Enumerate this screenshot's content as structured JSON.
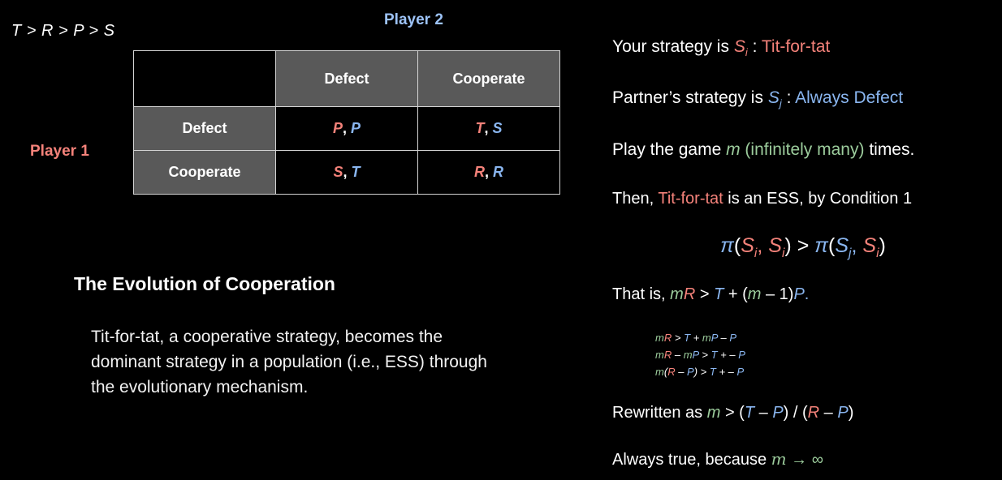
{
  "colors": {
    "background": "#000000",
    "player1": "#f4827a",
    "player2": "#8ab6f0",
    "variable_m": "#9ccc9c",
    "text": "#ffffff",
    "grid_border": "#d4d4d4",
    "header_cell": "#595959"
  },
  "left": {
    "inequality": "T > R > P > S",
    "player2_label": "Player 2",
    "player1_label": "Player 1",
    "matrix": {
      "corner": "",
      "column_headers": [
        "Defect",
        "Cooperate"
      ],
      "row_headers": [
        "Defect",
        "Cooperate"
      ],
      "cells": [
        [
          {
            "p1": "P",
            "sep": ", ",
            "p2": "P"
          },
          {
            "p1": "T",
            "sep": ", ",
            "p2": "S"
          }
        ],
        [
          {
            "p1": "S",
            "sep": ", ",
            "p2": "T"
          },
          {
            "p1": "R",
            "sep": ", ",
            "p2": "R"
          }
        ]
      ]
    },
    "evolution": {
      "title": "The Evolution of Cooperation",
      "body": "Tit-for-tat, a cooperative strategy, becomes the dominant strategy in a population (i.e., ESS) through the evolutionary mechanism."
    }
  },
  "right": {
    "line1": {
      "prefix": "Your strategy is ",
      "symbol": "S",
      "subscript": "i",
      "colon": " : ",
      "value": "Tit-for-tat"
    },
    "line2": {
      "prefix": "Partner’s strategy is ",
      "symbol": "S",
      "subscript": "j",
      "colon": " : ",
      "value": "Always Defect"
    },
    "line3": {
      "prefix": "Play the game ",
      "m": "m",
      "paren": " (infinitely many)",
      "suffix": " times."
    },
    "line4": {
      "prefix": "Then, ",
      "strategy": "Tit-for-tat",
      "suffix": " is an ESS, by Condition 1"
    },
    "pi_equation": {
      "pi": "π",
      "left_args": [
        "S",
        "i",
        "S",
        "i"
      ],
      "operator": " > ",
      "right_args": [
        "S",
        "j",
        "S",
        "i"
      ],
      "plain": "π(Si, Si) > π(Sj, Si)"
    },
    "line6": {
      "prefix": "That is, ",
      "m": "m",
      "R": "R",
      "op": " > ",
      "T": "T",
      "plus": " + (",
      "m2": "m",
      "minus": " – 1)",
      "P": "P",
      "period": "."
    },
    "small_equations": [
      "mR > T + mP – P",
      "mR – mP > T + – P",
      "m(R – P) > T + – P"
    ],
    "line8": {
      "prefix": "Rewritten as ",
      "m": "m",
      "op": " > (",
      "T": "T",
      "minus1": " – ",
      "P1": "P",
      "slash": ") / (",
      "R": "R",
      "minus2": " – ",
      "P2": "P",
      "close": ")"
    },
    "line9": {
      "prefix": "Always true, because ",
      "m": "m",
      "arrow": " → ",
      "infinity": "∞"
    }
  }
}
